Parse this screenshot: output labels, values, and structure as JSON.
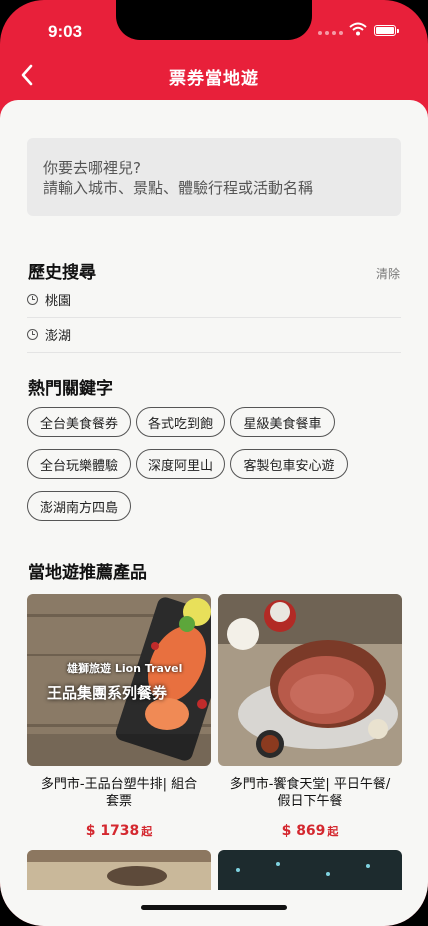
{
  "status_bar": {
    "time": "9:03"
  },
  "nav": {
    "title": "票券當地遊"
  },
  "search": {
    "line1": "你要去哪裡兒?",
    "line2": "請輸入城市、景點、體驗行程或活動名稱"
  },
  "history": {
    "title": "歷史搜尋",
    "clear_label": "清除",
    "items": [
      "桃園",
      "澎湖"
    ]
  },
  "keywords": {
    "title": "熱門關鍵字",
    "tags": [
      "全台美食餐券",
      "各式吃到飽",
      "星級美食餐車",
      "全台玩樂體驗",
      "深度阿里山",
      "客製包車安心遊",
      "澎湖南方四島"
    ]
  },
  "recommend": {
    "title": "當地遊推薦產品",
    "products": [
      {
        "title_line1": "多門市-王品台塑牛排| 組合",
        "title_line2": "套票",
        "price": "$ 1738",
        "unit": "起",
        "image_text_line1": "雄獅旅遊 Lion Travel",
        "image_text_line2": "王品集團系列餐券"
      },
      {
        "title_line1": "多門市-饗食天堂| 平日午餐/",
        "title_line2": "假日下午餐",
        "price": "$ 869",
        "unit": "起"
      }
    ]
  },
  "colors": {
    "brand": "#e8203a",
    "price": "#d4282f"
  }
}
